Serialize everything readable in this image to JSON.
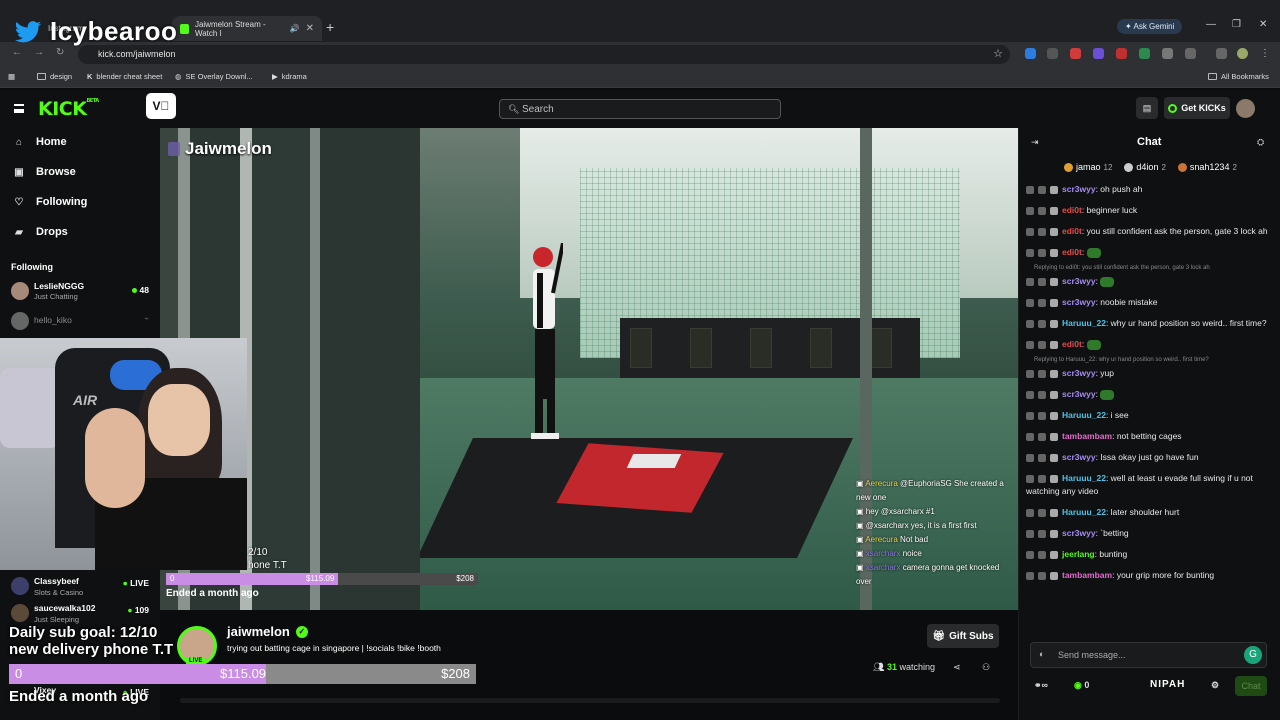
{
  "watermark": "Icybearoo",
  "browser": {
    "tabs": [
      {
        "label": "Instagram"
      },
      {
        "label": "Jaiwmelon Stream - Watch l"
      }
    ],
    "ask_gemini": "Ask Gemini",
    "url": "kick.com/jaiwmelon",
    "bookmarks": [
      "design",
      "blender cheat sheet",
      "SE Overlay Downl...",
      "kdrama"
    ],
    "all_bookmarks": "All Bookmarks"
  },
  "header": {
    "logo": "KICK",
    "logo_sup": "BETA",
    "search_placeholder": "Search",
    "get_kicks": "Get KICKs"
  },
  "sidebar": {
    "nav": [
      {
        "label": "Home",
        "icon": "home-icon"
      },
      {
        "label": "Browse",
        "icon": "browse-icon"
      },
      {
        "label": "Following",
        "icon": "heart-icon"
      },
      {
        "label": "Drops",
        "icon": "gift-icon"
      }
    ],
    "following_heading": "Following",
    "following": [
      {
        "name": "LeslieNGGG",
        "category": "Just Chatting",
        "viewers": "48"
      },
      {
        "name": "hello_kiko",
        "category": "",
        "viewers": ""
      }
    ],
    "following_lower": [
      {
        "name": "Classybeef",
        "category": "Slots & Casino",
        "viewers": "LIVE"
      },
      {
        "name": "saucewalka102",
        "category": "Just Sleeping",
        "viewers": "109"
      },
      {
        "name": "Vixey",
        "category": "",
        "viewers": "LIVE"
      }
    ]
  },
  "video": {
    "channel_title": "Jaiwmelon",
    "overlay_chat": [
      {
        "user": "Aerecura",
        "text": "@EuphoriaSG She created a new one"
      },
      {
        "user": "",
        "text": "hey @xsarcharx #1"
      },
      {
        "user": "",
        "text": "@xsarcharx yes, it is a first first"
      },
      {
        "user": "Aerecura",
        "text": "Not bad"
      },
      {
        "user": "xsarcharx",
        "text": "noice"
      },
      {
        "user": "xsarcharx",
        "text": "camera gonna get knocked over"
      }
    ]
  },
  "goal": {
    "line1": "Daily sub goal: 12/10",
    "line2": "new delivery phone T.T",
    "line1_small": "2/10",
    "line2_small": "hone T.T",
    "start": "0",
    "current": "$115.09",
    "target": "$208",
    "progress_fraction": 0.55,
    "ended": "Ended a month ago"
  },
  "stream": {
    "streamer": "jaiwmelon",
    "live_badge": "LIVE",
    "title": "trying out batting cage in singapore | !socials !bike !booth",
    "gift_subs": "Gift Subs",
    "watching_count": "31",
    "watching_label": "watching"
  },
  "chat": {
    "title": "Chat",
    "leaderboard": [
      {
        "name": "jamao",
        "count": "12",
        "color": "#e0a030"
      },
      {
        "name": "d4ion",
        "count": "2",
        "color": "#cccccc"
      },
      {
        "name": "snah1234",
        "count": "2",
        "color": "#c9733a"
      }
    ],
    "messages": [
      {
        "user": "scr3wyy",
        "color": "#a58cf0",
        "text": "oh push ah",
        "reply": ""
      },
      {
        "user": "edi0t",
        "color": "#e84a4a",
        "text": "beginner luck",
        "reply": ""
      },
      {
        "user": "edi0t",
        "color": "#e84a4a",
        "text": "you still confident ask the person, gate 3 lock ah",
        "reply": ""
      },
      {
        "user": "edi0t",
        "color": "#e84a4a",
        "text": "",
        "reply": ""
      },
      {
        "user": "scr3wyy",
        "color": "#a58cf0",
        "text": "",
        "reply": "Replying to edi0t: you still confident ask the person, gate 3 lock ah"
      },
      {
        "user": "scr3wyy",
        "color": "#a58cf0",
        "text": "noobie mistake",
        "reply": ""
      },
      {
        "user": "Haruuu_22",
        "color": "#4ec3e8",
        "text": "why ur hand position so weird.. first time?",
        "reply": ""
      },
      {
        "user": "edi0t",
        "color": "#e84a4a",
        "text": "",
        "reply": ""
      },
      {
        "user": "scr3wyy",
        "color": "#a58cf0",
        "text": "yup",
        "reply": "Replying to Haruuu_22: why ur hand position so weird.. first time?"
      },
      {
        "user": "scr3wyy",
        "color": "#a58cf0",
        "text": "",
        "reply": ""
      },
      {
        "user": "Haruuu_22",
        "color": "#4ec3e8",
        "text": "i see",
        "reply": ""
      },
      {
        "user": "tambambam",
        "color": "#e56bd0",
        "text": "not betting cages",
        "reply": ""
      },
      {
        "user": "scr3wyy",
        "color": "#a58cf0",
        "text": "Issa okay just go have fun",
        "reply": ""
      },
      {
        "user": "Haruuu_22",
        "color": "#4ec3e8",
        "text": "well at least u evade full swing if u not watching any video",
        "reply": ""
      },
      {
        "user": "Haruuu_22",
        "color": "#4ec3e8",
        "text": "later shoulder hurt",
        "reply": ""
      },
      {
        "user": "scr3wyy",
        "color": "#a58cf0",
        "text": "`betting",
        "reply": ""
      },
      {
        "user": "jeerlang",
        "color": "#53fc18",
        "text": "bunting",
        "reply": ""
      },
      {
        "user": "tambambam",
        "color": "#e56bd0",
        "text": "your grip more for bunting",
        "reply": ""
      }
    ],
    "input_placeholder": "Send message...",
    "kicks_count": "0",
    "nipah": "NIPAH",
    "send_label": "Chat"
  }
}
